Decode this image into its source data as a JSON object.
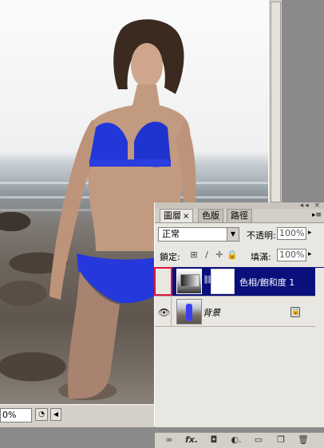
{
  "document": {
    "zoom": "0%",
    "status_button": "◔",
    "scroll_left": "◀"
  },
  "layers_panel": {
    "menu_button": "▸≡",
    "window_controls": "◂◂ ×",
    "tabs": [
      {
        "label": "圖層",
        "active": true,
        "close": "×"
      },
      {
        "label": "色版",
        "active": false
      },
      {
        "label": "路徑",
        "active": false
      }
    ],
    "blend_mode": "正常",
    "opacity_label": "不透明:",
    "opacity_value": "100%",
    "lock_label": "鎖定:",
    "fill_label": "填滿:",
    "fill_value": "100%",
    "lock_icons": [
      "transparent-lock-icon",
      "brush-lock-icon",
      "move-lock-icon",
      "padlock-icon"
    ],
    "layers": [
      {
        "name": "色相/飽和度 1",
        "type": "adjustment",
        "selected": true,
        "visible": false
      },
      {
        "name": "背景",
        "type": "background",
        "selected": false,
        "visible": true,
        "locked": true
      }
    ],
    "bottom_buttons": [
      "link-icon",
      "fx-icon",
      "mask-icon",
      "adjustment-icon",
      "folder-icon",
      "new-layer-icon",
      "trash-icon"
    ],
    "bottom_glyphs": [
      "∞",
      "fx.",
      "◘",
      "◐.",
      "▭",
      "❐",
      "🗑"
    ],
    "colors": {
      "selected_row": "#0a0f7c",
      "highlight_border": "#e0143c",
      "panel_bg": "#e9e7e2"
    }
  }
}
